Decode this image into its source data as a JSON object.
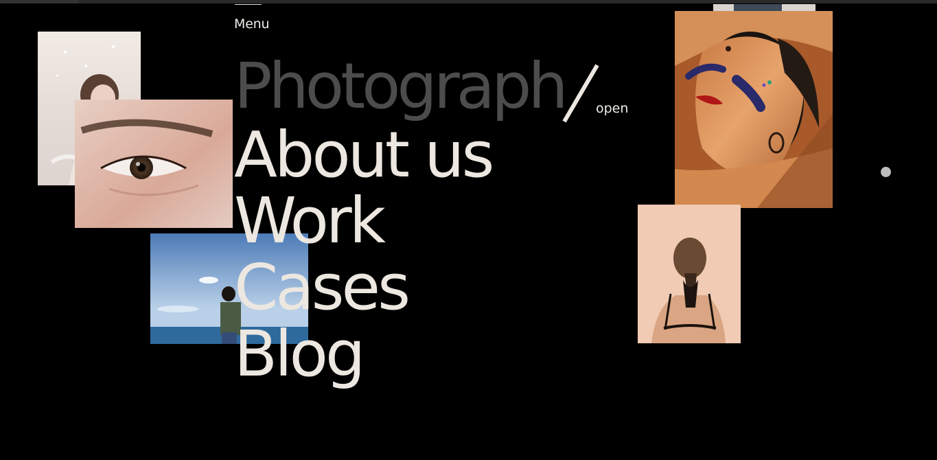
{
  "menu": {
    "label": "Menu"
  },
  "nav": {
    "items": [
      {
        "label": "Photograph",
        "state": "current"
      },
      {
        "label": "About us"
      },
      {
        "label": "Work"
      },
      {
        "label": "Cases"
      },
      {
        "label": "Blog"
      }
    ],
    "open_label": "open"
  },
  "colors": {
    "background": "#000000",
    "nav_text": "#ece7e0",
    "nav_text_current": "#4c4c4c",
    "cursor_dot": "#bdbdbd"
  },
  "photos": [
    {
      "name": "photo-woman-light"
    },
    {
      "name": "photo-eye"
    },
    {
      "name": "photo-woman-sea"
    },
    {
      "name": "photo-face-paint"
    },
    {
      "name": "photo-woman-back"
    },
    {
      "name": "photo-top-partial"
    }
  ]
}
